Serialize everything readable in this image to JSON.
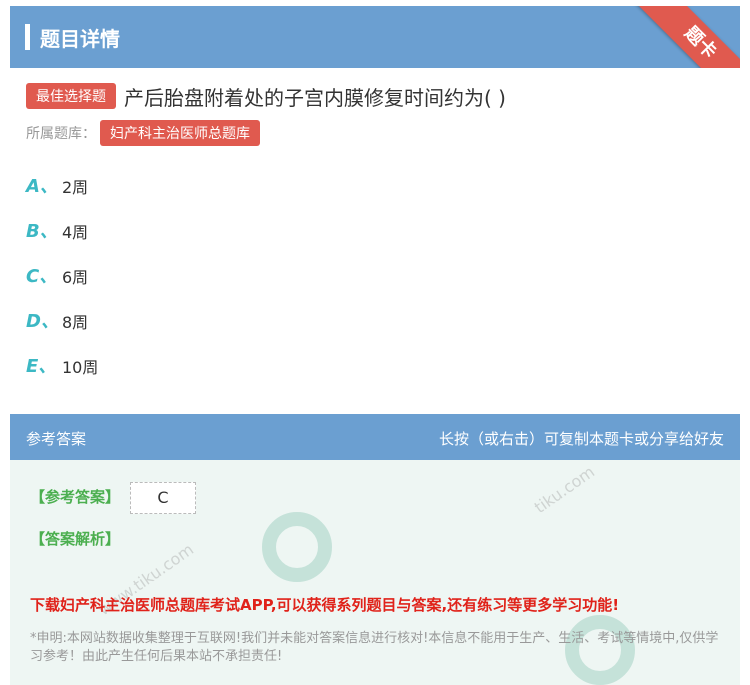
{
  "header": {
    "title": "题目详情",
    "ribbon": "题卡"
  },
  "question": {
    "type_badge": "最佳选择题",
    "text": "产后胎盘附着处的子宫内膜修复时间约为(    )",
    "bank_label": "所属题库：",
    "bank_name": "妇产科主治医师总题库"
  },
  "options": [
    {
      "letter": "A、",
      "text": "2周"
    },
    {
      "letter": "B、",
      "text": "4周"
    },
    {
      "letter": "C、",
      "text": "6周"
    },
    {
      "letter": "D、",
      "text": "8周"
    },
    {
      "letter": "E、",
      "text": "10周"
    }
  ],
  "answer_bar": {
    "left": "参考答案",
    "right": "长按（或右击）可复制本题卡或分享给好友"
  },
  "answer": {
    "answer_label": "【参考答案】",
    "answer_value": "C",
    "explanation_label": "【答案解析】",
    "promo": "下载妇产科主治医师总题库考试APP,可以获得系列题目与答案,还有练习等更多学习功能!",
    "disclaimer": "*申明:本网站数据收集整理于互联网!我们并未能对答案信息进行核对!本信息不能用于生产、生活、考试等情境中,仅供学习参考！由此产生任何后果本站不承担责任!"
  },
  "colors": {
    "header_bg": "#6b9fd1",
    "accent_red": "#e05a4f",
    "option_teal": "#3cb8c4",
    "answer_green": "#4caf50"
  }
}
